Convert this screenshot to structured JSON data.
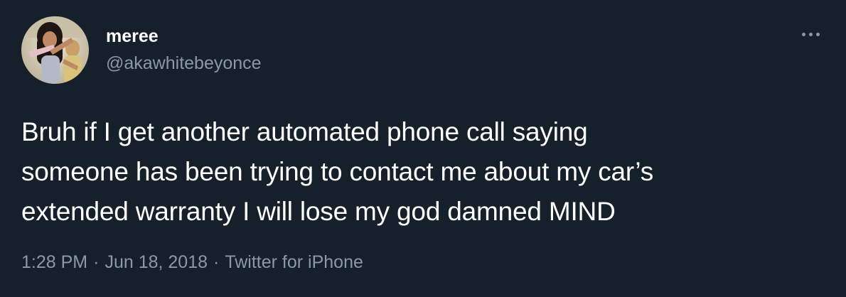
{
  "user": {
    "display_name": "meree",
    "handle": "@akawhitebeyonce"
  },
  "menu": {
    "icon": "more-horizontal-icon"
  },
  "tweet": {
    "text_lines": [
      "Bruh if I get another automated phone call saying",
      "someone has been trying to contact me about my car’s",
      "extended warranty I will lose my god damned MIND"
    ]
  },
  "meta": {
    "time": "1:28 PM",
    "separator": "·",
    "date": "Jun 18, 2018",
    "source": "Twitter for iPhone"
  },
  "colors": {
    "background": "#15202b",
    "primary_text": "#ffffff",
    "secondary_text": "#8b98a5"
  }
}
